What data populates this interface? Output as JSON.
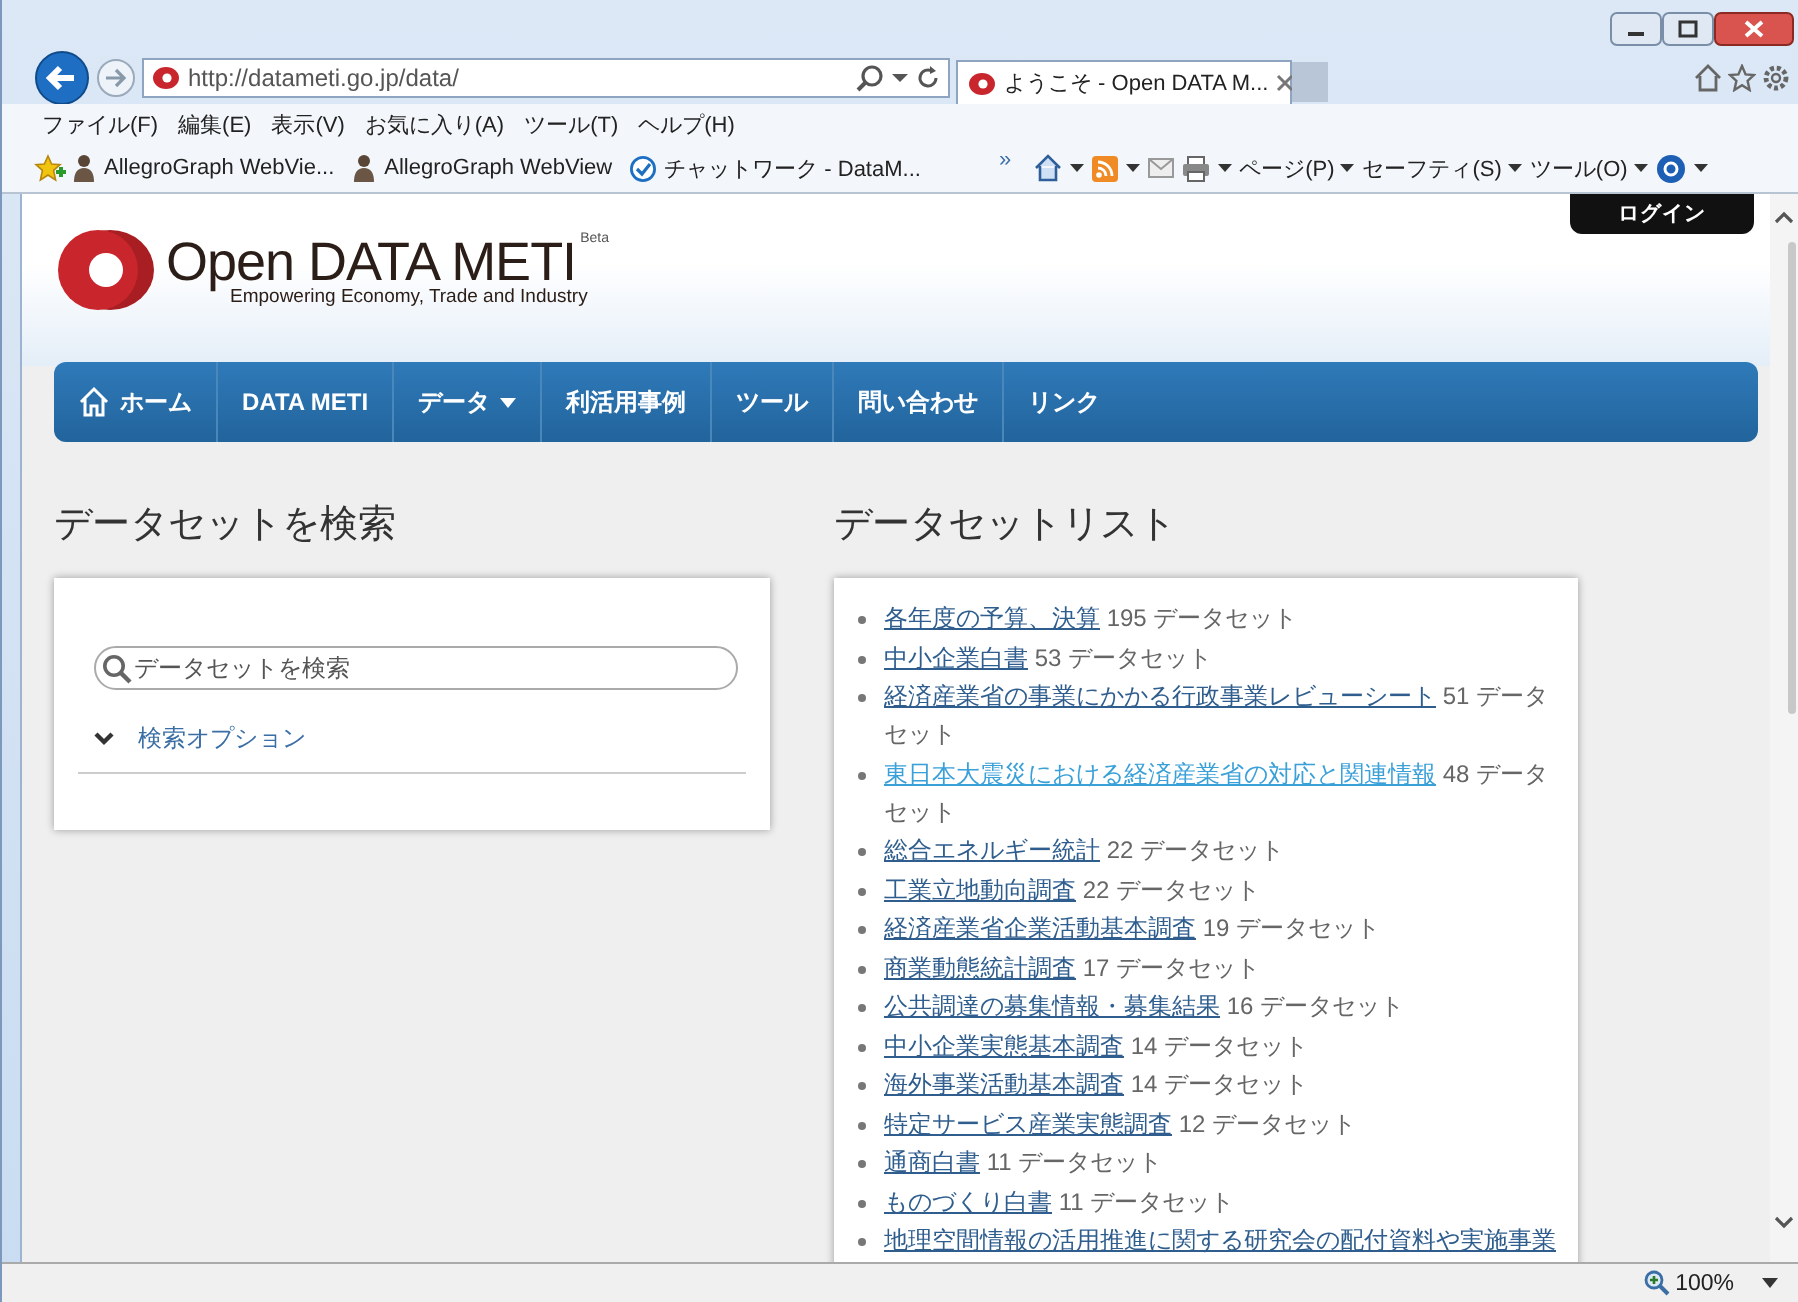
{
  "browser": {
    "address": "http://datameti.go.jp/data/",
    "tabs": [
      {
        "title": "ようこそ - Open DATA M...",
        "selected": true
      }
    ],
    "menu": [
      "ファイル(F)",
      "編集(E)",
      "表示(V)",
      "お気に入り(A)",
      "ツール(T)",
      "ヘルプ(H)"
    ],
    "favorites": [
      {
        "label": "AllegroGraph WebVie...",
        "kind": "figure"
      },
      {
        "label": "AllegroGraph WebView",
        "kind": "figure"
      },
      {
        "label": "チャットワーク - DataM...",
        "kind": "check"
      }
    ],
    "overflow": "»",
    "commands": [
      {
        "label": "ページ(P)",
        "kind": "menu"
      },
      {
        "label": "セーフティ(S)",
        "kind": "menu"
      },
      {
        "label": "ツール(O)",
        "kind": "menu"
      }
    ],
    "zoom": "100%"
  },
  "page": {
    "login": "ログイン",
    "logo": {
      "title": "Open DATA METI",
      "beta": "Beta",
      "tagline": "Empowering Economy, Trade and Industry"
    },
    "nav": [
      {
        "label": "ホーム",
        "kind": "home"
      },
      {
        "label": "DATA METI",
        "kind": "plain"
      },
      {
        "label": "データ",
        "kind": "dropdown"
      },
      {
        "label": "利活用事例",
        "kind": "plain"
      },
      {
        "label": "ツール",
        "kind": "plain"
      },
      {
        "label": "問い合わせ",
        "kind": "plain"
      },
      {
        "label": "リンク",
        "kind": "plain"
      }
    ],
    "search": {
      "heading": "データセットを検索",
      "placeholder": "データセットを検索",
      "options": "検索オプション",
      "expanded": false
    },
    "datasets": {
      "heading": "データセットリスト",
      "items": [
        {
          "name": "各年度の予算、決算",
          "count": "195 データセット",
          "highlighted": false
        },
        {
          "name": "中小企業白書",
          "count": "53 データセット",
          "highlighted": false
        },
        {
          "name": "経済産業省の事業にかかる行政事業レビューシート",
          "count": "51 データセット",
          "highlighted": false
        },
        {
          "name": "東日本大震災における経済産業省の対応と関連情報",
          "count": "48 データセット",
          "highlighted": true
        },
        {
          "name": "総合エネルギー統計",
          "count": "22 データセット",
          "highlighted": false
        },
        {
          "name": "工業立地動向調査",
          "count": "22 データセット",
          "highlighted": false
        },
        {
          "name": "経済産業省企業活動基本調査",
          "count": "19 データセット",
          "highlighted": false
        },
        {
          "name": "商業動態統計調査",
          "count": "17 データセット",
          "highlighted": false
        },
        {
          "name": "公共調達の募集情報・募集結果",
          "count": "16 データセット",
          "highlighted": false
        },
        {
          "name": "中小企業実態基本調査",
          "count": "14 データセット",
          "highlighted": false
        },
        {
          "name": "海外事業活動基本調査",
          "count": "14 データセット",
          "highlighted": false
        },
        {
          "name": "特定サービス産業実態調査",
          "count": "12 データセット",
          "highlighted": false
        },
        {
          "name": "通商白書",
          "count": "11 データセット",
          "highlighted": false
        },
        {
          "name": "ものづくり白書",
          "count": "11 データセット",
          "highlighted": false
        },
        {
          "name": "地理空間情報の活用推進に関する研究会の配付資料や実施事業",
          "highlighted": false
        }
      ]
    }
  }
}
